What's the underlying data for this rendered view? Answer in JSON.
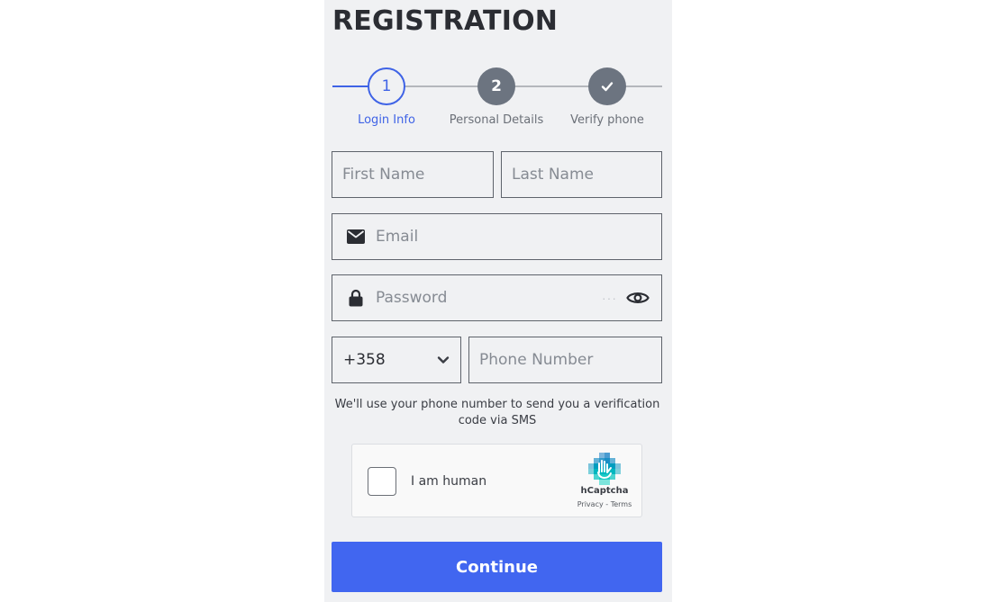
{
  "page": {
    "title": "REGISTRATION"
  },
  "stepper": {
    "steps": [
      {
        "number": "1",
        "label": "Login Info",
        "state": "active"
      },
      {
        "number": "2",
        "label": "Personal Details",
        "state": "pending"
      },
      {
        "icon": "check-icon",
        "label": "Verify phone",
        "state": "pending"
      }
    ]
  },
  "form": {
    "first_name": {
      "placeholder": "First Name",
      "value": ""
    },
    "last_name": {
      "placeholder": "Last Name",
      "value": ""
    },
    "email": {
      "placeholder": "Email",
      "value": "",
      "icon": "envelope-icon"
    },
    "password": {
      "placeholder": "Password",
      "value": "",
      "icon": "lock-icon",
      "toggle_icon": "eye-icon",
      "dots": "···"
    },
    "country_code": {
      "value": "+358",
      "icon": "chevron-down-icon"
    },
    "phone": {
      "placeholder": "Phone Number",
      "value": ""
    },
    "hint": "We'll use your phone number to send you a verification code via SMS"
  },
  "captcha": {
    "label": "I am human",
    "brand": "hCaptcha",
    "privacy_link": "Privacy",
    "separator": " - ",
    "terms_link": "Terms"
  },
  "actions": {
    "continue_label": "Continue"
  },
  "colors": {
    "accent": "#4166f0",
    "step_inactive": "#6c7480",
    "panel_bg": "#f0f1f3"
  }
}
